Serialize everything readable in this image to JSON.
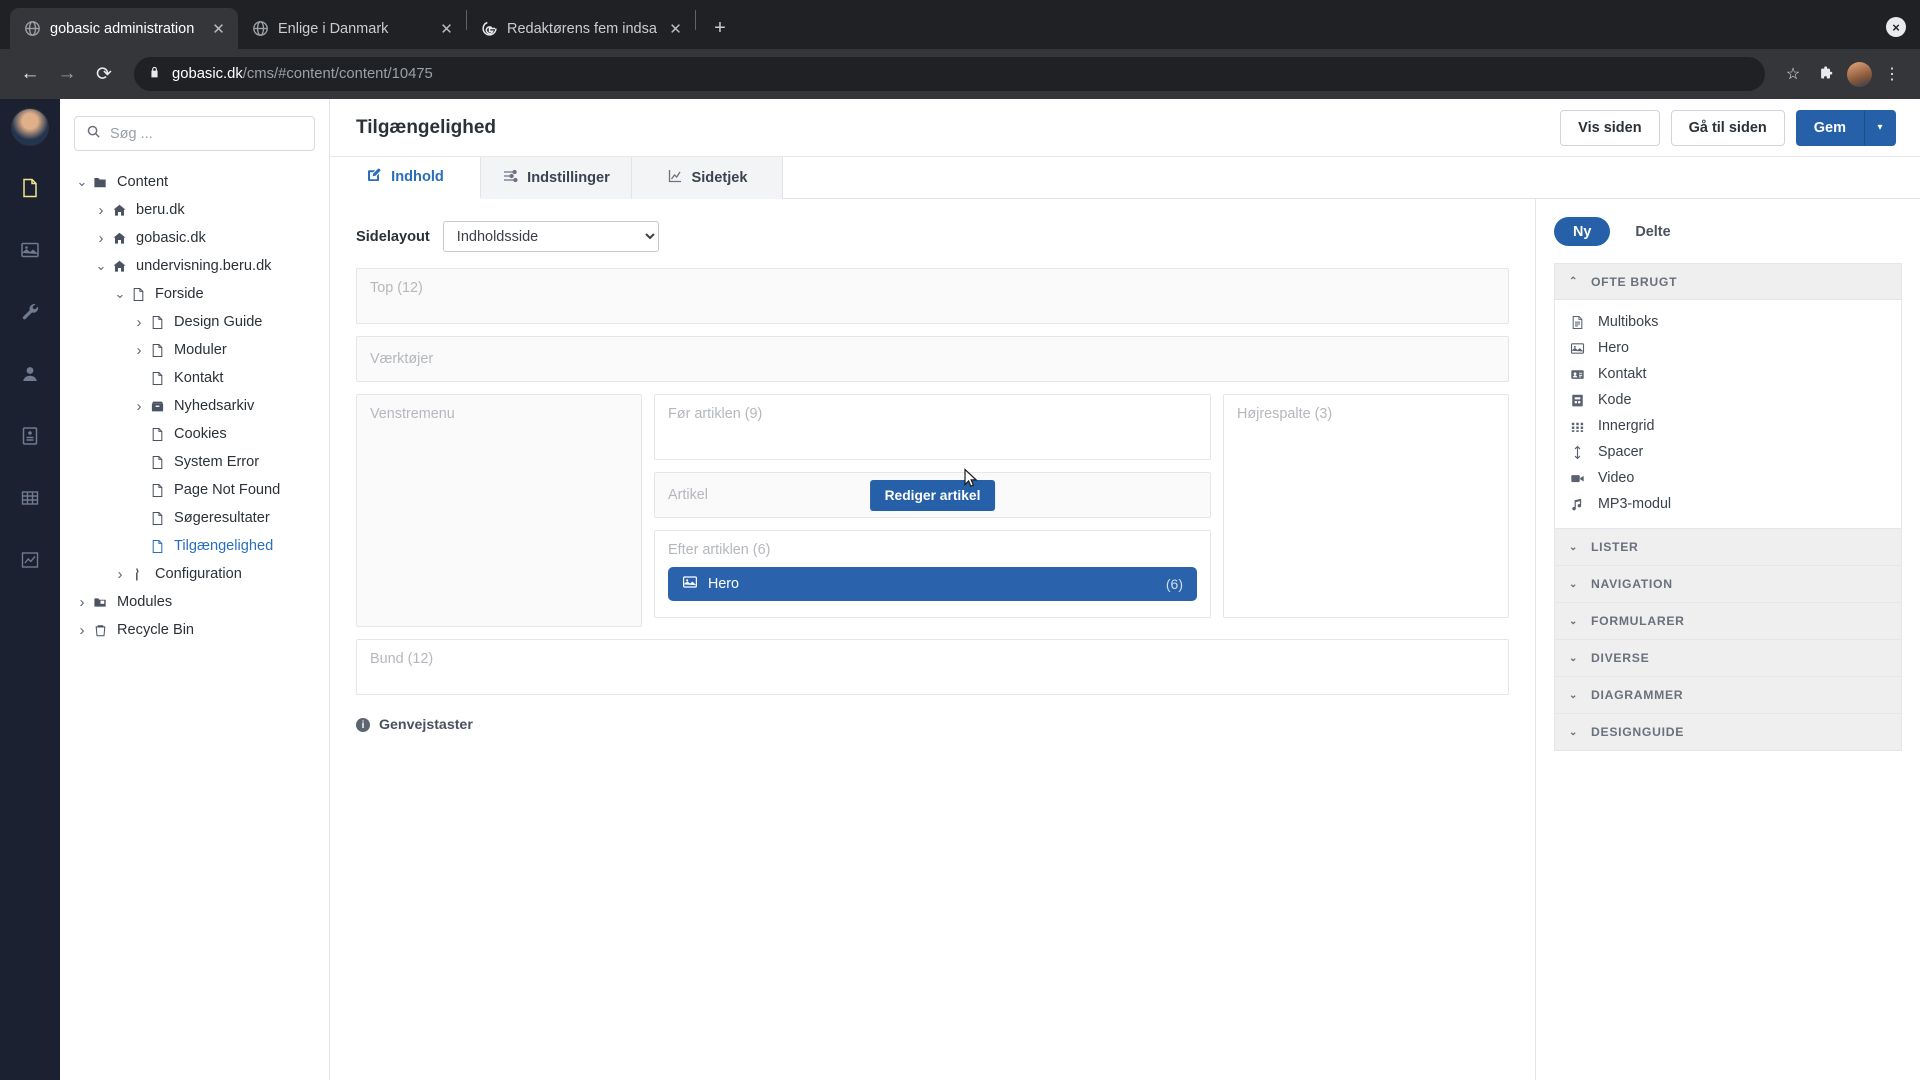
{
  "browser": {
    "tabs": [
      {
        "title": "gobasic administration",
        "favicon": "globe-icon",
        "active": true
      },
      {
        "title": "Enlige i Danmark",
        "favicon": "globe-icon",
        "active": false
      },
      {
        "title": "Redaktørens fem indsatsområ",
        "favicon": "google-docs-icon",
        "active": false
      }
    ],
    "newtab_label": "+",
    "window_close_label": "×",
    "url": {
      "host": "gobasic.dk",
      "path": "/cms/#content/content/10475"
    },
    "nav": {
      "back": "←",
      "forward": "→",
      "reload": "⟳"
    }
  },
  "rail": {
    "items": [
      {
        "name": "content",
        "icon": "document-icon",
        "active": true
      },
      {
        "name": "media",
        "icon": "image-icon",
        "active": false
      },
      {
        "name": "settings",
        "icon": "wrench-icon",
        "active": false
      },
      {
        "name": "users",
        "icon": "user-icon",
        "active": false
      },
      {
        "name": "forms",
        "icon": "form-card-icon",
        "active": false
      },
      {
        "name": "tables",
        "icon": "grid-table-icon",
        "active": false
      },
      {
        "name": "analytics",
        "icon": "chart-line-icon",
        "active": false
      }
    ]
  },
  "sidebar": {
    "search": {
      "placeholder": "Søg ...",
      "value": "",
      "icon": "search-icon"
    },
    "tree": [
      {
        "label": "Content",
        "icon": "folder-icon",
        "depth": 0,
        "caret": "down",
        "selected": false
      },
      {
        "label": "beru.dk",
        "icon": "home-icon",
        "depth": 1,
        "caret": "right",
        "selected": false
      },
      {
        "label": "gobasic.dk",
        "icon": "home-icon",
        "depth": 1,
        "caret": "right",
        "selected": false
      },
      {
        "label": "undervisning.beru.dk",
        "icon": "home-icon",
        "depth": 1,
        "caret": "down",
        "selected": false
      },
      {
        "label": "Forside",
        "icon": "page-icon",
        "depth": 2,
        "caret": "down",
        "selected": false
      },
      {
        "label": "Design Guide",
        "icon": "page-icon",
        "depth": 3,
        "caret": "right",
        "selected": false
      },
      {
        "label": "Moduler",
        "icon": "page-icon",
        "depth": 3,
        "caret": "right",
        "selected": false
      },
      {
        "label": "Kontakt",
        "icon": "page-icon",
        "depth": 3,
        "caret": "none",
        "selected": false
      },
      {
        "label": "Nyhedsarkiv",
        "icon": "archive-icon",
        "depth": 3,
        "caret": "right",
        "selected": false
      },
      {
        "label": "Cookies",
        "icon": "page-icon",
        "depth": 3,
        "caret": "none",
        "selected": false
      },
      {
        "label": "System Error",
        "icon": "page-icon",
        "depth": 3,
        "caret": "none",
        "selected": false
      },
      {
        "label": "Page Not Found",
        "icon": "page-icon",
        "depth": 3,
        "caret": "none",
        "selected": false
      },
      {
        "label": "Søgeresultater",
        "icon": "page-icon",
        "depth": 3,
        "caret": "none",
        "selected": false
      },
      {
        "label": "Tilgængelighed",
        "icon": "page-icon",
        "depth": 3,
        "caret": "none",
        "selected": true
      },
      {
        "label": "Configuration",
        "icon": "tools-icon",
        "depth": 2,
        "caret": "right",
        "selected": false
      },
      {
        "label": "Modules",
        "icon": "modules-icon",
        "depth": 0,
        "caret": "right",
        "selected": false
      },
      {
        "label": "Recycle Bin",
        "icon": "trash-icon",
        "depth": 0,
        "caret": "right",
        "selected": false
      }
    ]
  },
  "header": {
    "title": "Tilgængelighed",
    "buttons": {
      "view_page": "Vis siden",
      "go_to_page": "Gå til siden",
      "save": "Gem",
      "save_dropdown": "▾"
    }
  },
  "tabs": [
    {
      "label": "Indhold",
      "icon": "edit-square-icon",
      "active": true
    },
    {
      "label": "Indstillinger",
      "icon": "sliders-icon",
      "active": false
    },
    {
      "label": "Sidetjek",
      "icon": "chart-line-icon",
      "active": false
    }
  ],
  "canvas": {
    "layout_label": "Sidelayout",
    "layout_value": "Indholdsside",
    "layout_options": [
      "Indholdsside"
    ],
    "zones": {
      "top": "Top (12)",
      "tools": "Værktøjer",
      "left_menu": "Venstremenu",
      "before_article": "Før artiklen (9)",
      "article": "Artikel",
      "edit_article_button": "Rediger artikel",
      "after_article": "Efter artiklen (6)",
      "right_column": "Højrespalte (3)",
      "bottom": "Bund (12)"
    },
    "module_chip": {
      "label": "Hero",
      "count": "(6)",
      "icon": "image-icon"
    },
    "shortcuts": {
      "label": "Genvejstaster",
      "icon": "info-icon"
    }
  },
  "right_panel": {
    "toggle": {
      "new": "Ny",
      "shared": "Delte",
      "active": "Ny"
    },
    "sections": [
      {
        "title": "OFTE BRUGT",
        "expanded": true,
        "caret": "up",
        "items": [
          {
            "label": "Multiboks",
            "icon": "document-lines-icon"
          },
          {
            "label": "Hero",
            "icon": "image-icon"
          },
          {
            "label": "Kontakt",
            "icon": "contact-card-icon"
          },
          {
            "label": "Kode",
            "icon": "code-block-icon"
          },
          {
            "label": "Innergrid",
            "icon": "grid-dots-icon"
          },
          {
            "label": "Spacer",
            "icon": "vertical-arrows-icon"
          },
          {
            "label": "Video",
            "icon": "video-camera-icon"
          },
          {
            "label": "MP3-modul",
            "icon": "music-note-icon"
          }
        ]
      },
      {
        "title": "LISTER",
        "expanded": false,
        "caret": "down",
        "items": []
      },
      {
        "title": "NAVIGATION",
        "expanded": false,
        "caret": "down",
        "items": []
      },
      {
        "title": "FORMULARER",
        "expanded": false,
        "caret": "down",
        "items": []
      },
      {
        "title": "DIVERSE",
        "expanded": false,
        "caret": "down",
        "items": []
      },
      {
        "title": "DIAGRAMMER",
        "expanded": false,
        "caret": "down",
        "items": []
      },
      {
        "title": "DESIGNGUIDE",
        "expanded": false,
        "caret": "down",
        "items": []
      }
    ]
  },
  "colors": {
    "accent": "#2560a8",
    "chip": "#2a63ab",
    "selected_tree": "#2a6ebb",
    "rail_bg": "#1b2130",
    "rail_active": "#f0e68c"
  }
}
